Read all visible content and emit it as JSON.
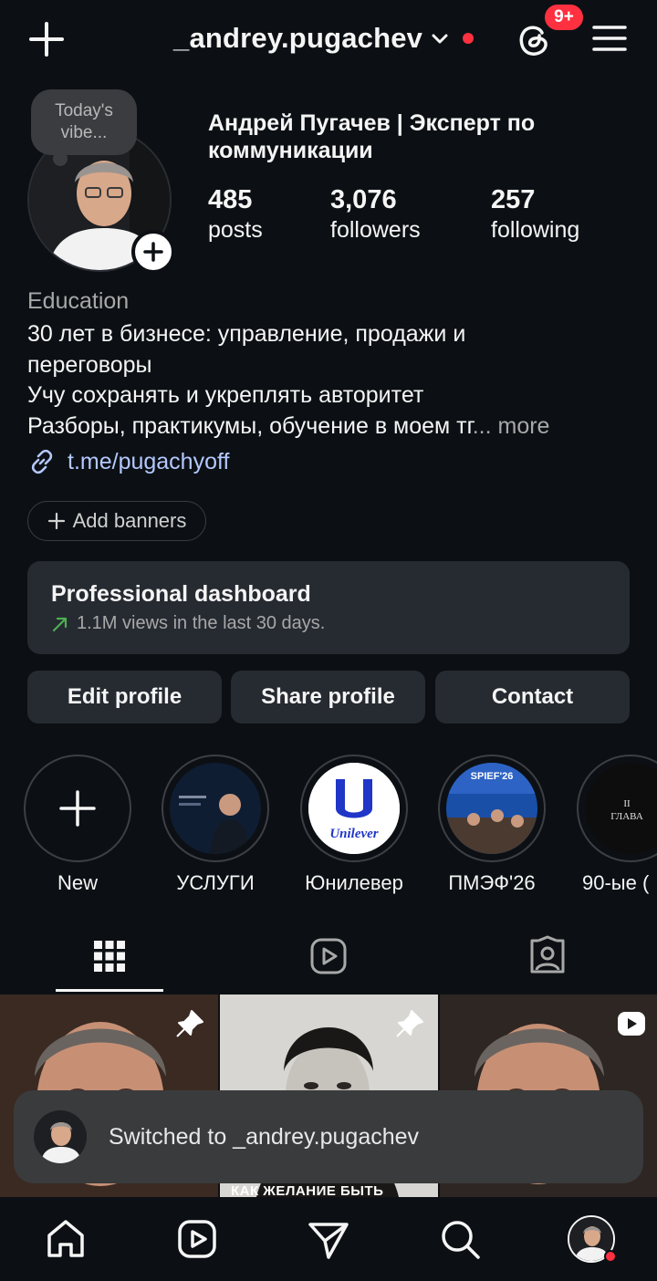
{
  "header": {
    "username": "_andrey.pugachev",
    "notification_badge": "9+",
    "icons": [
      "plus-icon",
      "chevron-down-icon",
      "threads-icon",
      "menu-icon"
    ]
  },
  "profile": {
    "note": "Today's vibe...",
    "full_name": "Андрей Пугачев | Эксперт по коммуникации",
    "stats": [
      {
        "value": "485",
        "label": "posts"
      },
      {
        "value": "3,076",
        "label": "followers"
      },
      {
        "value": "257",
        "label": "following"
      }
    ],
    "category": "Education",
    "bio_lines": [
      "30 лет в бизнесе: управление, продажи и",
      "переговоры",
      "Учу сохранять и укреплять авторитет",
      "Разборы, практикумы, обучение в моем тг"
    ],
    "bio_ellipsis": "...",
    "bio_more": "more",
    "link": "t.me/pugachyoff"
  },
  "add_banners": "Add banners",
  "dashboard": {
    "title": "Professional dashboard",
    "subtitle": "1.1M views in the last 30 days."
  },
  "actions": {
    "edit": "Edit profile",
    "share": "Share profile",
    "contact": "Contact"
  },
  "highlights": [
    {
      "label": "New"
    },
    {
      "label": "УСЛУГИ"
    },
    {
      "label": "Юнилевер",
      "logo_text": "Unilever"
    },
    {
      "label": "ПМЭФ'26",
      "image_text": "SPIEF'26"
    },
    {
      "label": "90-ые (",
      "image_text": "II ГЛАВА"
    }
  ],
  "grid": {
    "caption_2": "КАК ЖЕЛАНИЕ БЫТЬ"
  },
  "toast": {
    "text": "Switched to _andrey.pugachev"
  },
  "colors": {
    "background": "#0c1014",
    "card": "#262a31",
    "accent_red": "#ff3040",
    "link": "#b4c8ff",
    "trend_green": "#4caf50"
  }
}
